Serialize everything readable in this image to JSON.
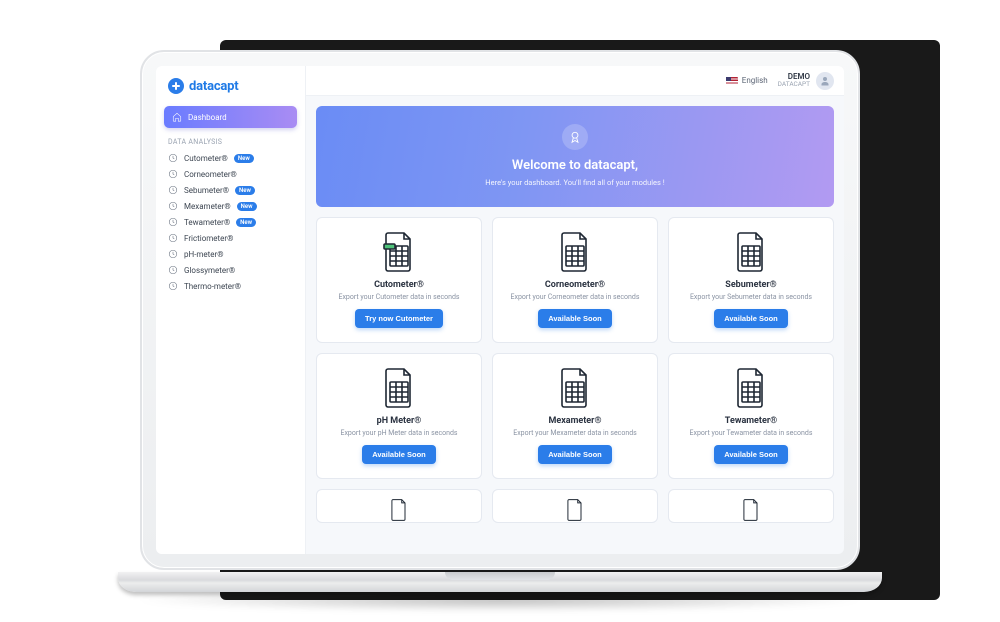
{
  "brand": {
    "name": "datacapt"
  },
  "sidebar": {
    "active": {
      "label": "Dashboard"
    },
    "section_label": "DATA ANALYSIS",
    "items": [
      {
        "label": "Cutometer®",
        "badge": "New"
      },
      {
        "label": "Corneometer®",
        "badge": null
      },
      {
        "label": "Sebumeter®",
        "badge": "New"
      },
      {
        "label": "Mexameter®",
        "badge": "New"
      },
      {
        "label": "Tewameter®",
        "badge": "New"
      },
      {
        "label": "Frictiometer®",
        "badge": null
      },
      {
        "label": "pH-meter®",
        "badge": null
      },
      {
        "label": "Glossymeter®",
        "badge": null
      },
      {
        "label": "Thermo-meter®",
        "badge": null
      }
    ]
  },
  "topbar": {
    "language": "English",
    "demo_label": "DEMO",
    "org": "DATACAPT"
  },
  "hero": {
    "title": "Welcome to datacapt,",
    "subtitle": "Here's your dashboard. You'll find all of your modules !"
  },
  "modules": [
    {
      "title": "Cutometer®",
      "desc": "Export your Cutometer data in seconds",
      "button": "Try now Cutometer",
      "accent": "green"
    },
    {
      "title": "Corneometer®",
      "desc": "Export your Corneometer data in seconds",
      "button": "Available Soon",
      "accent": "none"
    },
    {
      "title": "Sebumeter®",
      "desc": "Export your Sebumeter data in seconds",
      "button": "Available Soon",
      "accent": "none"
    },
    {
      "title": "pH Meter®",
      "desc": "Export your pH Meter data in seconds",
      "button": "Available Soon",
      "accent": "none"
    },
    {
      "title": "Mexameter®",
      "desc": "Export your Mexameter data in seconds",
      "button": "Available Soon",
      "accent": "none"
    },
    {
      "title": "Tewameter®",
      "desc": "Export your Tewameter data in seconds",
      "button": "Available Soon",
      "accent": "none"
    }
  ]
}
